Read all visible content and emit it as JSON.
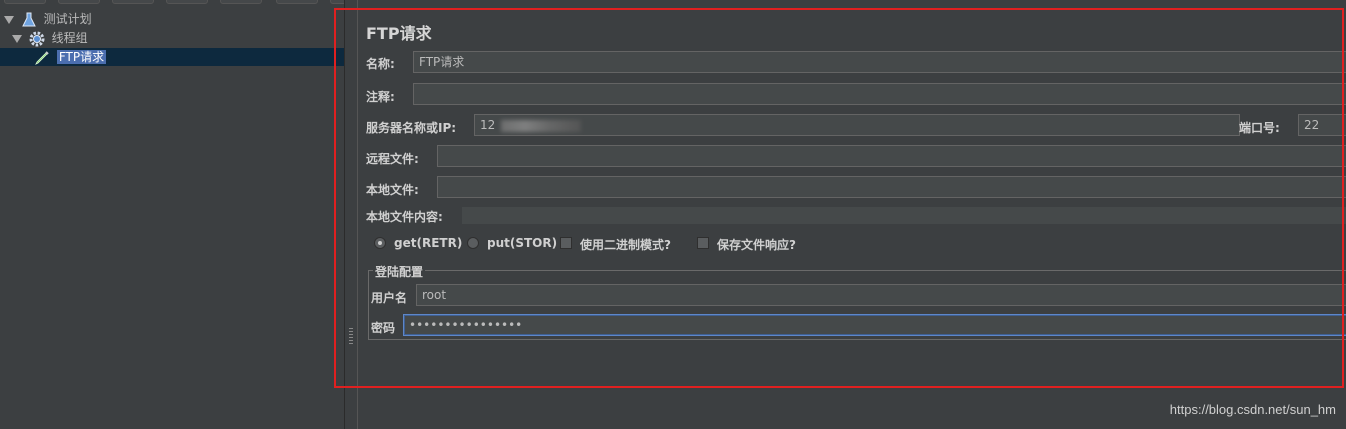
{
  "tree": {
    "items": [
      {
        "label": "测试计划",
        "icon": "test-plan-icon"
      },
      {
        "label": "线程组",
        "icon": "gear-icon"
      },
      {
        "label": "FTP请求",
        "icon": "pipette-icon"
      }
    ]
  },
  "form": {
    "title": "FTP请求",
    "name_label": "名称:",
    "name_value": "FTP请求",
    "comment_label": "注释:",
    "comment_value": "",
    "server_label": "服务器名称或IP:",
    "server_value": "12",
    "port_label": "端口号:",
    "port_value": "22",
    "remote_label": "远程文件:",
    "remote_value": "",
    "local_label": "本地文件:",
    "local_value": "",
    "local_content_label": "本地文件内容:",
    "local_content_value": "",
    "options": {
      "get_label": "get(RETR)",
      "put_label": "put(STOR)",
      "binary_label": "使用二进制模式?",
      "save_label": "保存文件响应?",
      "selected": "get(RETR)"
    },
    "login": {
      "legend": "登陆配置",
      "user_label": "用户名",
      "user_value": "root",
      "password_label": "密码",
      "password_value": "••••••••••••••••"
    }
  },
  "watermark": "https://blog.csdn.net/sun_hm",
  "colors": {
    "background": "#3c3f41",
    "selection": "#4b6eaf",
    "highlight_frame": "#e02020"
  }
}
